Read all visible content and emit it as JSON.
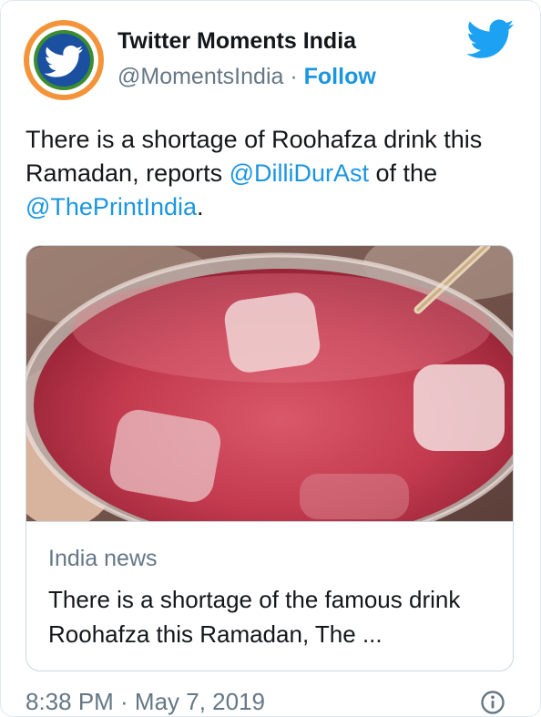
{
  "tweet": {
    "author": {
      "name": "Twitter Moments India",
      "handle": "@MomentsIndia",
      "separator": "·",
      "follow_label": "Follow",
      "avatar_icon": "twitter-bird-tricolor-avatar"
    },
    "text": {
      "part1": "There is a shortage of Roohafza drink this Ramadan, reports ",
      "mention1": "@DilliDurAst",
      "part2": " of the ",
      "mention2": "@ThePrintIndia",
      "part3": "."
    },
    "link_card": {
      "image_alt": "glass of Roohafza drink with ice cubes and a straw",
      "domain": "India news",
      "title": "There is a shortage of the famous drink Roohafza this Ramadan, The ..."
    },
    "timestamp": "8:38 PM · May 7, 2019",
    "brand_icon": "twitter-bird-icon",
    "info_icon": "info-icon",
    "colors": {
      "twitter_blue": "#1da1f2",
      "link_blue": "#1b95e0",
      "secondary_text": "#657786",
      "saffron": "#f4943a",
      "india_green": "#3c8d2f"
    }
  }
}
